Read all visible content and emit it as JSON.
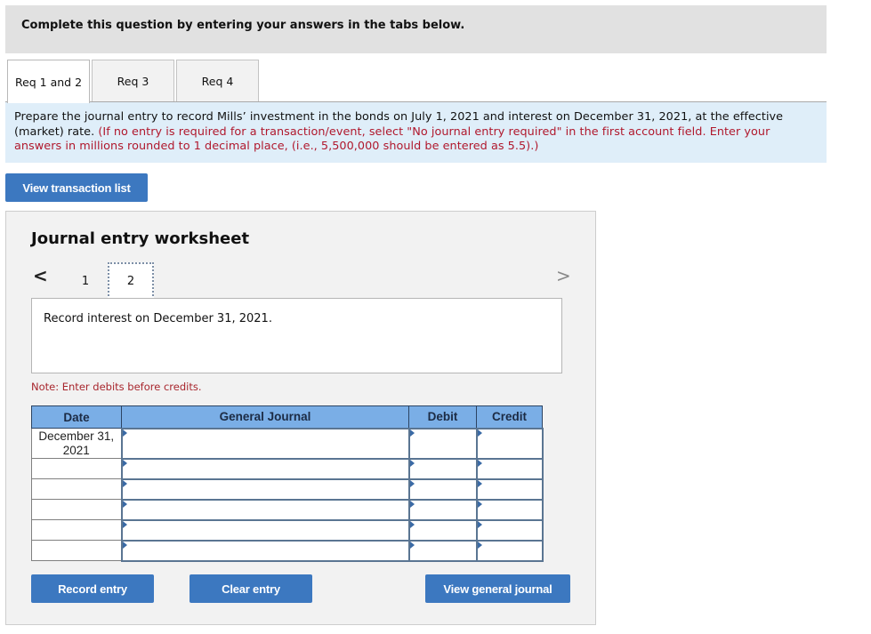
{
  "instruction": "Complete this question by entering your answers in the tabs below.",
  "tabs": [
    {
      "label": "Req 1 and 2",
      "active": true
    },
    {
      "label": "Req 3",
      "active": false
    },
    {
      "label": "Req 4",
      "active": false
    }
  ],
  "prompt": {
    "main": "Prepare the journal entry to record Mills’ investment in the bonds on July 1, 2021 and interest on December 31, 2021, at the effective (market) rate.",
    "note_red": "(If no entry is required for a transaction/event, select \"No journal entry required\" in the first account field. Enter your answers in millions rounded to 1 decimal place, (i.e., 5,500,000 should be entered as 5.5).)"
  },
  "buttons": {
    "view_transaction_list": "View transaction list",
    "record_entry": "Record entry",
    "clear_entry": "Clear entry",
    "view_general_journal": "View general journal"
  },
  "worksheet": {
    "title": "Journal entry worksheet",
    "nav": {
      "prev_icon": "chevron-left-icon",
      "next_icon": "chevron-right-icon",
      "prev_glyph": "<",
      "next_glyph": ">"
    },
    "pages": [
      "1",
      "2"
    ],
    "current_page": "2",
    "description": "Record interest on December 31, 2021.",
    "note": "Note: Enter debits before credits.",
    "table": {
      "headers": {
        "date": "Date",
        "account": "General Journal",
        "debit": "Debit",
        "credit": "Credit"
      },
      "rows": [
        {
          "date": "December 31, 2021",
          "account": "",
          "debit": "",
          "credit": ""
        },
        {
          "date": "",
          "account": "",
          "debit": "",
          "credit": ""
        },
        {
          "date": "",
          "account": "",
          "debit": "",
          "credit": ""
        },
        {
          "date": "",
          "account": "",
          "debit": "",
          "credit": ""
        },
        {
          "date": "",
          "account": "",
          "debit": "",
          "credit": ""
        },
        {
          "date": "",
          "account": "",
          "debit": "",
          "credit": ""
        }
      ]
    }
  },
  "colors": {
    "button_blue": "#3c78c0",
    "header_blue": "#7aaee6",
    "prompt_bg": "#dfeef9",
    "note_red": "#b0182d"
  }
}
